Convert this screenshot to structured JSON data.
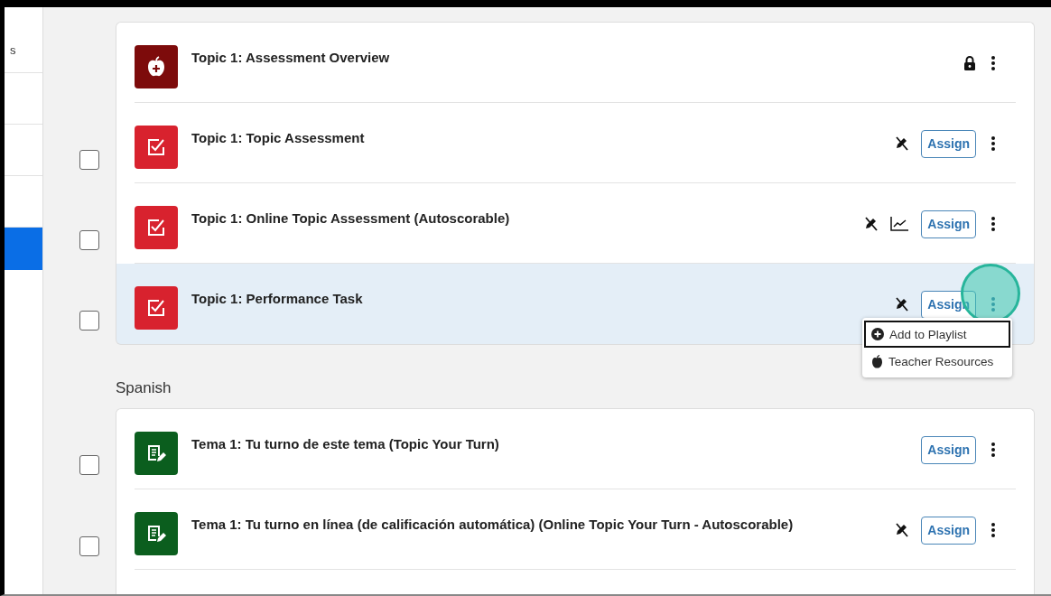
{
  "sidebar": {
    "items": [
      {
        "label": "s",
        "selected": false
      },
      {
        "selected": false
      },
      {
        "selected": false
      },
      {
        "selected": false
      },
      {
        "selected": true
      }
    ]
  },
  "sections": [
    {
      "items": [
        {
          "kind": "overview",
          "title": "Topic 1: Assessment Overview",
          "locked": true,
          "highlighted": false
        },
        {
          "kind": "assessment",
          "title": "Topic 1: Topic Assessment",
          "checked": false,
          "no_edit": true,
          "assign": "Assign",
          "highlighted": false
        },
        {
          "kind": "assessment",
          "title": "Topic 1: Online Topic Assessment (Autoscorable)",
          "checked": false,
          "no_edit": true,
          "report": true,
          "assign": "Assign",
          "highlighted": false
        },
        {
          "kind": "assessment",
          "title": "Topic 1: Performance Task",
          "checked": false,
          "no_edit": true,
          "assign": "Assign",
          "highlighted": true,
          "menu": [
            {
              "label": "Add to Playlist",
              "selected": true
            },
            {
              "label": "Teacher Resources",
              "selected": false
            }
          ]
        }
      ]
    },
    {
      "heading": "Spanish",
      "items": [
        {
          "kind": "practice",
          "title": "Tema 1: Tu turno de este tema (Topic Your Turn)",
          "checked": false,
          "assign": "Assign",
          "highlighted": false
        },
        {
          "kind": "practice",
          "title": "Tema 1: Tu turno en línea (de calificación automática) (Online Topic Your Turn - Autoscorable)",
          "checked": false,
          "no_edit": true,
          "assign": "Assign",
          "highlighted": false
        }
      ],
      "more": true
    }
  ]
}
